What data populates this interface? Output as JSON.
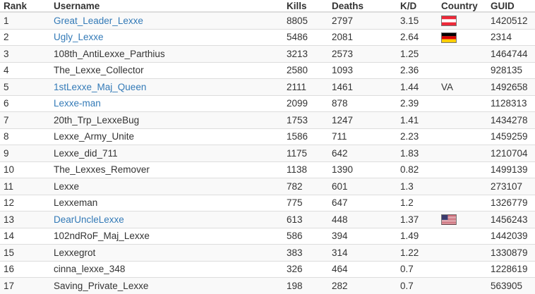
{
  "headers": {
    "rank": "Rank",
    "username": "Username",
    "kills": "Kills",
    "deaths": "Deaths",
    "kd": "K/D",
    "country": "Country",
    "guid": "GUID"
  },
  "rows": [
    {
      "rank": "1",
      "username": "Great_Leader_Lexxe",
      "link": true,
      "kills": "8805",
      "deaths": "2797",
      "kd": "3.15",
      "country_flag": "austria-flag-icon",
      "country_text": "",
      "guid": "1420512"
    },
    {
      "rank": "2",
      "username": "Ugly_Lexxe",
      "link": true,
      "kills": "5486",
      "deaths": "2081",
      "kd": "2.64",
      "country_flag": "germany-flag-icon",
      "country_text": "",
      "guid": "2314"
    },
    {
      "rank": "3",
      "username": "108th_AntiLexxe_Parthius",
      "link": false,
      "kills": "3213",
      "deaths": "2573",
      "kd": "1.25",
      "country_flag": "",
      "country_text": "",
      "guid": "1464744"
    },
    {
      "rank": "4",
      "username": "The_Lexxe_Collector",
      "link": false,
      "kills": "2580",
      "deaths": "1093",
      "kd": "2.36",
      "country_flag": "",
      "country_text": "",
      "guid": "928135"
    },
    {
      "rank": "5",
      "username": "1stLexxe_Maj_Queen",
      "link": true,
      "kills": "2111",
      "deaths": "1461",
      "kd": "1.44",
      "country_flag": "",
      "country_text": "VA",
      "guid": "1492658"
    },
    {
      "rank": "6",
      "username": "Lexxe-man",
      "link": true,
      "kills": "2099",
      "deaths": "878",
      "kd": "2.39",
      "country_flag": "",
      "country_text": "",
      "guid": "1128313"
    },
    {
      "rank": "7",
      "username": "20th_Trp_LexxeBug",
      "link": false,
      "kills": "1753",
      "deaths": "1247",
      "kd": "1.41",
      "country_flag": "",
      "country_text": "",
      "guid": "1434278"
    },
    {
      "rank": "8",
      "username": "Lexxe_Army_Unite",
      "link": false,
      "kills": "1586",
      "deaths": "711",
      "kd": "2.23",
      "country_flag": "",
      "country_text": "",
      "guid": "1459259"
    },
    {
      "rank": "9",
      "username": "Lexxe_did_711",
      "link": false,
      "kills": "1175",
      "deaths": "642",
      "kd": "1.83",
      "country_flag": "",
      "country_text": "",
      "guid": "1210704"
    },
    {
      "rank": "10",
      "username": "The_Lexxes_Remover",
      "link": false,
      "kills": "1138",
      "deaths": "1390",
      "kd": "0.82",
      "country_flag": "",
      "country_text": "",
      "guid": "1499139"
    },
    {
      "rank": "11",
      "username": "Lexxe",
      "link": false,
      "kills": "782",
      "deaths": "601",
      "kd": "1.3",
      "country_flag": "",
      "country_text": "",
      "guid": "273107"
    },
    {
      "rank": "12",
      "username": "Lexxeman",
      "link": false,
      "kills": "775",
      "deaths": "647",
      "kd": "1.2",
      "country_flag": "",
      "country_text": "",
      "guid": "1326779"
    },
    {
      "rank": "13",
      "username": "DearUncleLexxe",
      "link": true,
      "kills": "613",
      "deaths": "448",
      "kd": "1.37",
      "country_flag": "usa-flag-icon",
      "country_text": "",
      "guid": "1456243"
    },
    {
      "rank": "14",
      "username": "102ndRoF_Maj_Lexxe",
      "link": false,
      "kills": "586",
      "deaths": "394",
      "kd": "1.49",
      "country_flag": "",
      "country_text": "",
      "guid": "1442039"
    },
    {
      "rank": "15",
      "username": "Lexxegrot",
      "link": false,
      "kills": "383",
      "deaths": "314",
      "kd": "1.22",
      "country_flag": "",
      "country_text": "",
      "guid": "1330879"
    },
    {
      "rank": "16",
      "username": "cinna_lexxe_348",
      "link": false,
      "kills": "326",
      "deaths": "464",
      "kd": "0.7",
      "country_flag": "",
      "country_text": "",
      "guid": "1228619"
    },
    {
      "rank": "17",
      "username": "Saving_Private_Lexxe",
      "link": false,
      "kills": "198",
      "deaths": "282",
      "kd": "0.7",
      "country_flag": "",
      "country_text": "",
      "guid": "563905"
    }
  ],
  "colors": {
    "link": "#337ab7",
    "text": "#333333",
    "stripe": "#f9f9f9",
    "border": "#dddddd"
  }
}
